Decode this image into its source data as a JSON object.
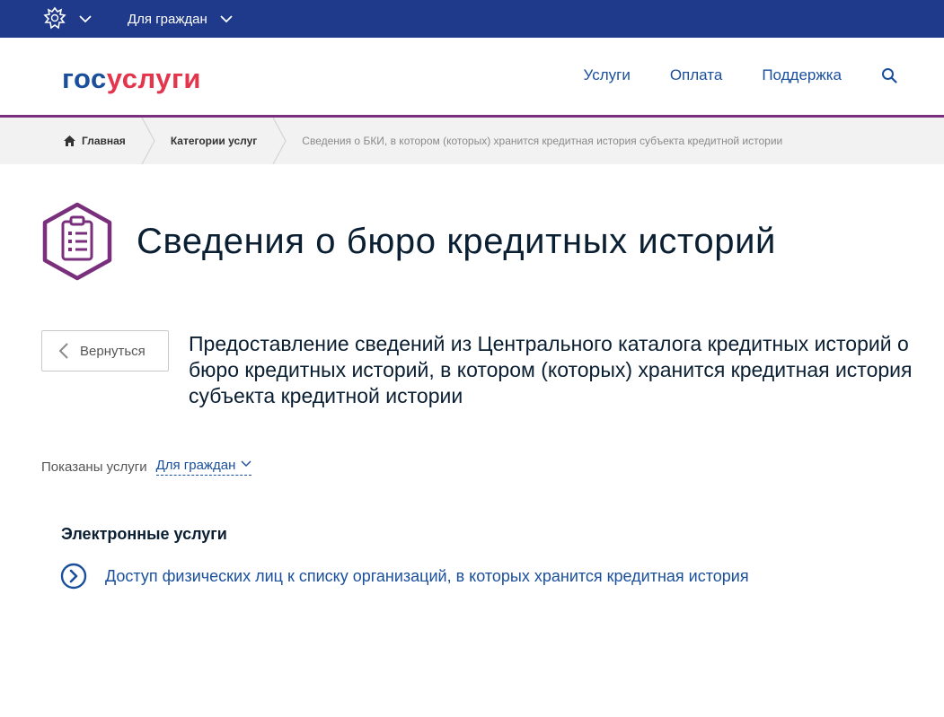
{
  "topbar": {
    "audience_label": "Для граждан",
    "icons": [
      "russian-emblem-icon",
      "chevron-down-icon"
    ]
  },
  "header": {
    "logo_gos": "гос",
    "logo_uslugi": "услуги",
    "nav": [
      {
        "label": "Услуги"
      },
      {
        "label": "Оплата"
      },
      {
        "label": "Поддержка"
      }
    ],
    "search_icon": "search-icon"
  },
  "breadcrumbs": {
    "home": "Главная",
    "categories": "Категории услуг",
    "current": "Сведения о БКИ, в котором (которых) хранится кредитная история субъекта кредитной истории"
  },
  "page": {
    "title": "Сведения о бюро кредитных историй",
    "back_label": "Вернуться",
    "description": "Предоставление сведений из Центрального каталога кредитных историй о бюро кредитных историй, в котором (которых) хранится кредитная история субъекта кредитной истории"
  },
  "filter": {
    "label": "Показаны услуги",
    "value": "Для граждан"
  },
  "services": {
    "title": "Электронные услуги",
    "items": [
      {
        "label": "Доступ физических лиц к списку организаций, в которых хранится кредитная история"
      }
    ]
  },
  "colors": {
    "topbar": "#1f3a8a",
    "brand_blue": "#1a4f9c",
    "brand_red": "#e3354c",
    "accent_purple": "#7a2f7d",
    "breadcrumb_bg": "#f2f2f2"
  }
}
